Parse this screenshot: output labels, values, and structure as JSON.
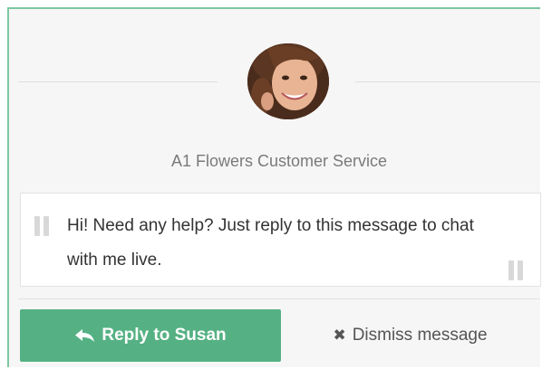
{
  "agent": {
    "name": "A1 Flowers Customer Service",
    "avatar_icon": "agent-avatar"
  },
  "message": {
    "text": "Hi! Need any help? Just reply to this message to chat with me live."
  },
  "actions": {
    "reply_label": "Reply to Susan",
    "reply_icon": "reply-arrow-icon",
    "dismiss_glyph": "✖",
    "dismiss_label": "Dismiss message"
  },
  "colors": {
    "accent": "#55b183",
    "border": "#7fc7a1"
  }
}
